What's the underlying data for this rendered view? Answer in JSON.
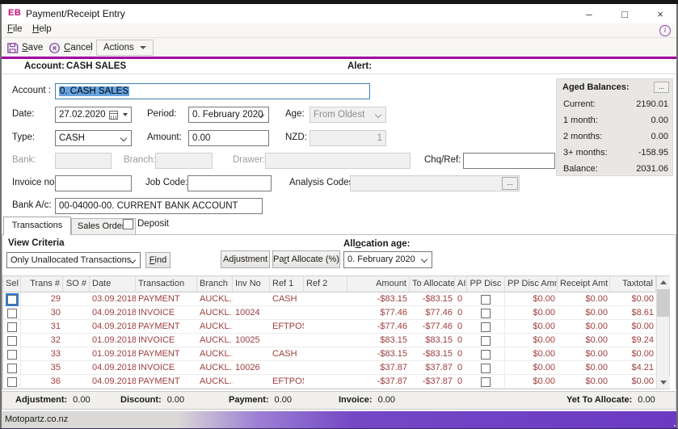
{
  "window": {
    "badge": "EB",
    "title": "Payment/Receipt Entry",
    "controls": {
      "minimize": "–",
      "maximize": "□",
      "close": "×"
    }
  },
  "menu": {
    "items": [
      {
        "label": "File"
      },
      {
        "label": "Help"
      }
    ]
  },
  "toolbar": {
    "save_label": "Save",
    "cancel_label": "Cancel",
    "actions_label": "Actions"
  },
  "header": {
    "account_label": "Account:",
    "account_value": "CASH SALES",
    "alert_label": "Alert:"
  },
  "form": {
    "account_label": "Account :",
    "account_value": "0. CASH SALES",
    "date_label": "Date:",
    "date_value": "27.02.2020",
    "period_label": "Period:",
    "period_value": "0. February 2020",
    "age_label": "Age:",
    "age_value": "From Oldest",
    "type_label": "Type:",
    "type_value": "CASH",
    "amount_label": "Amount:",
    "amount_value": "0.00",
    "nzd_label": "NZD:",
    "nzd_value": "1",
    "bank_label": "Bank:",
    "bank_value": "",
    "branch_label": "Branch:",
    "branch_value": "",
    "drawer_label": "Drawer:",
    "drawer_value": "",
    "chqref_label": "Chq/Ref:",
    "chqref_value": "",
    "invoice_no_label": "Invoice no:",
    "invoice_no_value": "",
    "job_code_label": "Job Code:",
    "job_code_value": "",
    "analysis_codes_label": "Analysis Codes:",
    "analysis_codes_value": "",
    "analysis_ellipsis": "...",
    "bank_ac_label": "Bank A/c:",
    "bank_ac_value": "00-04000-00. CURRENT BANK ACCOUNT"
  },
  "aged_balances": {
    "title": "Aged Balances:",
    "ellipsis": "...",
    "rows": [
      {
        "key": "current",
        "label": "Current:",
        "value": "2190.01"
      },
      {
        "key": "one_month",
        "label": "1 month:",
        "value": "0.00"
      },
      {
        "key": "two_months",
        "label": "2 months:",
        "value": "0.00"
      },
      {
        "key": "three_plus_months",
        "label": "3+ months:",
        "value": "-158.95"
      },
      {
        "key": "balance",
        "label": "Balance:",
        "value": "2031.06"
      }
    ]
  },
  "tabs": {
    "transactions": "Transactions",
    "sales_orders": "Sales Orders",
    "deposit_label": "Deposit",
    "deposit_checked": false
  },
  "view_criteria": {
    "title": "View Criteria",
    "filter_value": "Only Unallocated Transactions",
    "find_button": "Find",
    "adjustment_button": "Adjustment",
    "part_allocate_button": "Part Allocate (%)",
    "allocation_age_label": "Allocation age:",
    "allocation_age_value": "0. February 2020"
  },
  "grid": {
    "columns": [
      {
        "key": "sel",
        "label": "Sel",
        "width": 22,
        "align": "center",
        "type": "check"
      },
      {
        "key": "trans_no",
        "label": "Trans #",
        "width": 52,
        "align": "right"
      },
      {
        "key": "so_no",
        "label": "SO #",
        "width": 33,
        "align": "right"
      },
      {
        "key": "date",
        "label": "Date",
        "width": 57,
        "align": "left"
      },
      {
        "key": "transaction",
        "label": "Transaction",
        "width": 76,
        "align": "left"
      },
      {
        "key": "branch",
        "label": "Branch",
        "width": 44,
        "align": "left"
      },
      {
        "key": "inv_no",
        "label": "Inv No",
        "width": 46,
        "align": "left"
      },
      {
        "key": "ref1",
        "label": "Ref 1",
        "width": 42,
        "align": "left"
      },
      {
        "key": "ref2",
        "label": "Ref 2",
        "width": 54,
        "align": "left"
      },
      {
        "key": "amount",
        "label": "Amount",
        "width": 77,
        "align": "right"
      },
      {
        "key": "to_allocate",
        "label": "To Allocate",
        "width": 56,
        "align": "right",
        "header_align": "left"
      },
      {
        "key": "ai",
        "label": "AI",
        "width": 15,
        "align": "left"
      },
      {
        "key": "pp_disc",
        "label": "PP Disc",
        "width": 47,
        "align": "center",
        "type": "check"
      },
      {
        "key": "pp_disc_amnt",
        "label": "PP Disc Amnt",
        "width": 65,
        "align": "right"
      },
      {
        "key": "receipt_amt",
        "label": "Receipt Amt",
        "width": 65,
        "align": "right"
      },
      {
        "key": "taxtotal",
        "label": "Taxtotal",
        "width": 57,
        "align": "right"
      }
    ],
    "rows": [
      {
        "focused": true,
        "cells": [
          "",
          "29",
          "",
          "03.09.2018",
          "PAYMENT",
          "AUCKL...",
          "",
          "CASH",
          "",
          "-$83.15",
          "-$83.15",
          "0",
          "",
          "$0.00",
          "$0.00",
          "$0.00"
        ]
      },
      {
        "focused": false,
        "cells": [
          "",
          "30",
          "",
          "04.09.2018",
          "INVOICE",
          "AUCKL...",
          "10024",
          "",
          "",
          "$77.46",
          "$77.46",
          "0",
          "",
          "$0.00",
          "$0.00",
          "$8.61"
        ]
      },
      {
        "focused": false,
        "cells": [
          "",
          "31",
          "",
          "04.09.2018",
          "PAYMENT",
          "AUCKL...",
          "",
          "EFTPOS",
          "",
          "-$77.46",
          "-$77.46",
          "0",
          "",
          "$0.00",
          "$0.00",
          "$0.00"
        ]
      },
      {
        "focused": false,
        "cells": [
          "",
          "32",
          "",
          "01.09.2018",
          "INVOICE",
          "AUCKL...",
          "10025",
          "",
          "",
          "$83.15",
          "$83.15",
          "0",
          "",
          "$0.00",
          "$0.00",
          "$9.24"
        ]
      },
      {
        "focused": false,
        "cells": [
          "",
          "33",
          "",
          "01.09.2018",
          "PAYMENT",
          "AUCKL...",
          "",
          "CASH",
          "",
          "-$83.15",
          "-$83.15",
          "0",
          "",
          "$0.00",
          "$0.00",
          "$0.00"
        ]
      },
      {
        "focused": false,
        "cells": [
          "",
          "35",
          "",
          "04.09.2018",
          "INVOICE",
          "AUCKL...",
          "10026",
          "",
          "",
          "$37.87",
          "$37.87",
          "0",
          "",
          "$0.00",
          "$0.00",
          "$4.21"
        ]
      },
      {
        "focused": false,
        "cells": [
          "",
          "36",
          "",
          "04.09.2018",
          "PAYMENT",
          "AUCKL...",
          "",
          "EFTPOS",
          "",
          "-$37.87",
          "-$37.87",
          "0",
          "",
          "$0.00",
          "$0.00",
          "$0.00"
        ]
      }
    ]
  },
  "totals": {
    "items": [
      {
        "key": "adjustment",
        "label": "Adjustment:",
        "value": "0.00"
      },
      {
        "key": "discount",
        "label": "Discount:",
        "value": "0.00"
      },
      {
        "key": "payment",
        "label": "Payment:",
        "value": "0.00"
      },
      {
        "key": "invoice",
        "label": "Invoice:",
        "value": "0.00"
      },
      {
        "key": "yet_to_allocate",
        "label": "Yet To Allocate:",
        "value": "0.00"
      }
    ]
  },
  "status_bar": {
    "text": "Motopartz.co.nz"
  },
  "colors": {
    "accent_divider": "#a000a0",
    "brand_magenta": "#c9067c",
    "toolbar_icon_purple": "#7b3fa0",
    "status_bar_purple": "#6b3ac2",
    "grid_text_maroon": "#9e3e3e",
    "selection_blue": "#66a3e0"
  }
}
